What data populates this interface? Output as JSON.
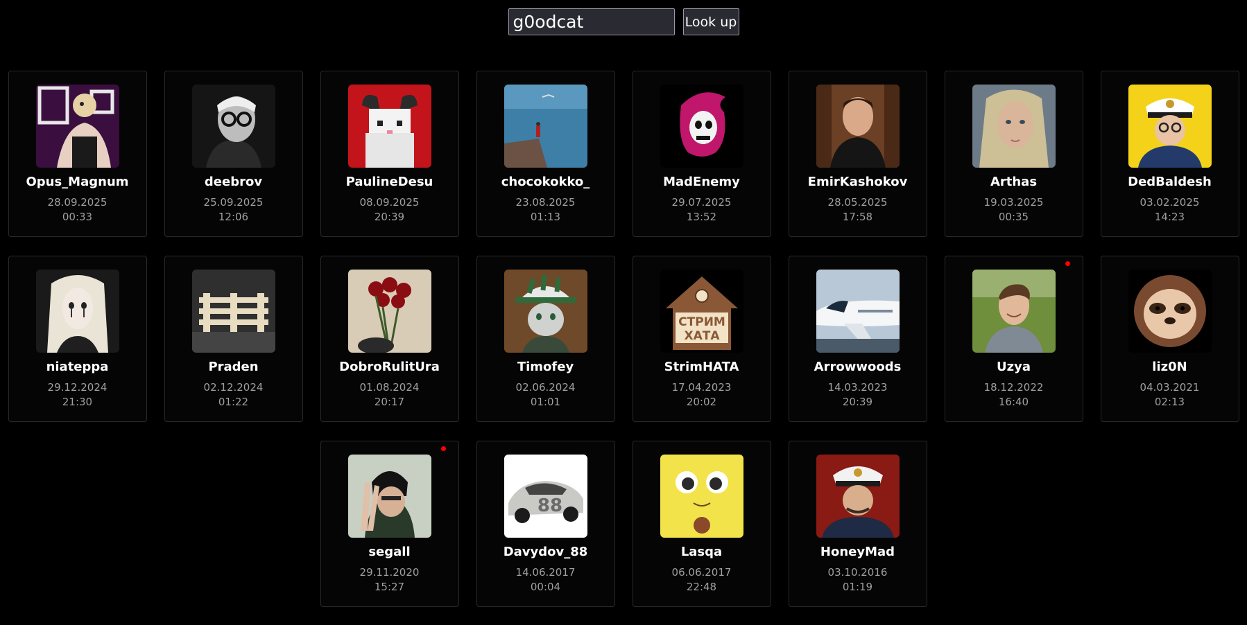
{
  "search": {
    "value": "g0odcat",
    "button_label": "Look up"
  },
  "accent_dot_color": "#ff0000",
  "cards": [
    {
      "username": "Opus_Magnum",
      "date": "28.09.2025",
      "time": "00:33",
      "live": false,
      "avatar": "anime-character-avatar"
    },
    {
      "username": "deebrov",
      "date": "25.09.2025",
      "time": "12:06",
      "live": false,
      "avatar": "bw-portrait-glasses-avatar"
    },
    {
      "username": "PaulineDesu",
      "date": "08.09.2025",
      "time": "20:39",
      "live": false,
      "avatar": "pixel-cat-horns-avatar"
    },
    {
      "username": "chocokokko_",
      "date": "23.08.2025",
      "time": "01:13",
      "live": false,
      "avatar": "sea-cliff-avatar"
    },
    {
      "username": "MadEnemy",
      "date": "29.07.2025",
      "time": "13:52",
      "live": false,
      "avatar": "pink-skull-avatar"
    },
    {
      "username": "EmirKashokov",
      "date": "28.05.2025",
      "time": "17:58",
      "live": false,
      "avatar": "man-portrait-avatar"
    },
    {
      "username": "Arthas",
      "date": "19.03.2025",
      "time": "00:35",
      "live": false,
      "avatar": "blonde-woman-avatar"
    },
    {
      "username": "DedBaldesh",
      "date": "03.02.2025",
      "time": "14:23",
      "live": false,
      "avatar": "captain-yellow-avatar"
    },
    {
      "username": "niateppa",
      "date": "29.12.2024",
      "time": "21:30",
      "live": false,
      "avatar": "pale-girl-avatar"
    },
    {
      "username": "Praden",
      "date": "02.12.2024",
      "time": "01:22",
      "live": false,
      "avatar": "wooden-pallet-avatar"
    },
    {
      "username": "DobroRulitUra",
      "date": "01.08.2024",
      "time": "20:17",
      "live": false,
      "avatar": "red-roses-avatar"
    },
    {
      "username": "Timofey",
      "date": "02.06.2024",
      "time": "01:01",
      "live": false,
      "avatar": "cat-bucket-hat-avatar"
    },
    {
      "username": "StrimHATA",
      "date": "17.04.2023",
      "time": "20:02",
      "live": false,
      "avatar": "house-logo-avatar",
      "logo_text": [
        "СТРИМ",
        "ХАТА"
      ]
    },
    {
      "username": "Arrowwoods",
      "date": "14.03.2023",
      "time": "20:39",
      "live": false,
      "avatar": "airplane-avatar"
    },
    {
      "username": "Uzya",
      "date": "18.12.2022",
      "time": "16:40",
      "live": true,
      "avatar": "smiling-man-avatar"
    },
    {
      "username": "liz0N",
      "date": "04.03.2021",
      "time": "02:13",
      "live": false,
      "avatar": "pixel-sloth-avatar"
    },
    {
      "username": "segall",
      "date": "29.11.2020",
      "time": "15:27",
      "live": true,
      "avatar": "peace-sign-man-avatar"
    },
    {
      "username": "Davydov_88",
      "date": "14.06.2017",
      "time": "00:04",
      "live": false,
      "avatar": "race-car-avatar",
      "logo_text": [
        "88"
      ]
    },
    {
      "username": "Lasqa",
      "date": "06.06.2017",
      "time": "22:48",
      "live": false,
      "avatar": "yellow-face-avatar"
    },
    {
      "username": "HoneyMad",
      "date": "03.10.2016",
      "time": "01:19",
      "live": false,
      "avatar": "captain-red-avatar"
    }
  ]
}
